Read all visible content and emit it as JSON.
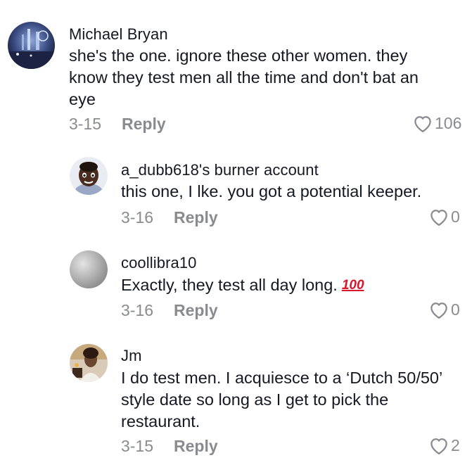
{
  "comments": [
    {
      "username": "Michael Bryan",
      "lines": [
        "she's the one. ignore these other women. they",
        "know they test men all the time and don't bat an",
        "eye"
      ],
      "date": "3-15",
      "reply_label": "Reply",
      "likes": "106"
    },
    {
      "username": "a_dubb618's burner account",
      "lines": [
        "this one, I lke. you got a potential keeper."
      ],
      "date": "3-16",
      "reply_label": "Reply",
      "likes": "0"
    },
    {
      "username": "coollibra10",
      "lines": [
        "Exactly, they test all day long."
      ],
      "emoji": "💯",
      "emoji_glyph": "100",
      "date": "3-16",
      "reply_label": "Reply",
      "likes": "0"
    },
    {
      "username": "Jm",
      "lines": [
        "I do test men. I acquiesce to a ‘Dutch 50/50’",
        "style date so long as I get to pick the",
        "restaurant."
      ],
      "date": "3-15",
      "reply_label": "Reply",
      "likes": "2"
    }
  ],
  "colors": {
    "text": "#161823",
    "muted": "#8a8b91",
    "emoji_red": "#d6172c"
  },
  "icons": {
    "like": "heart-outline-icon"
  }
}
